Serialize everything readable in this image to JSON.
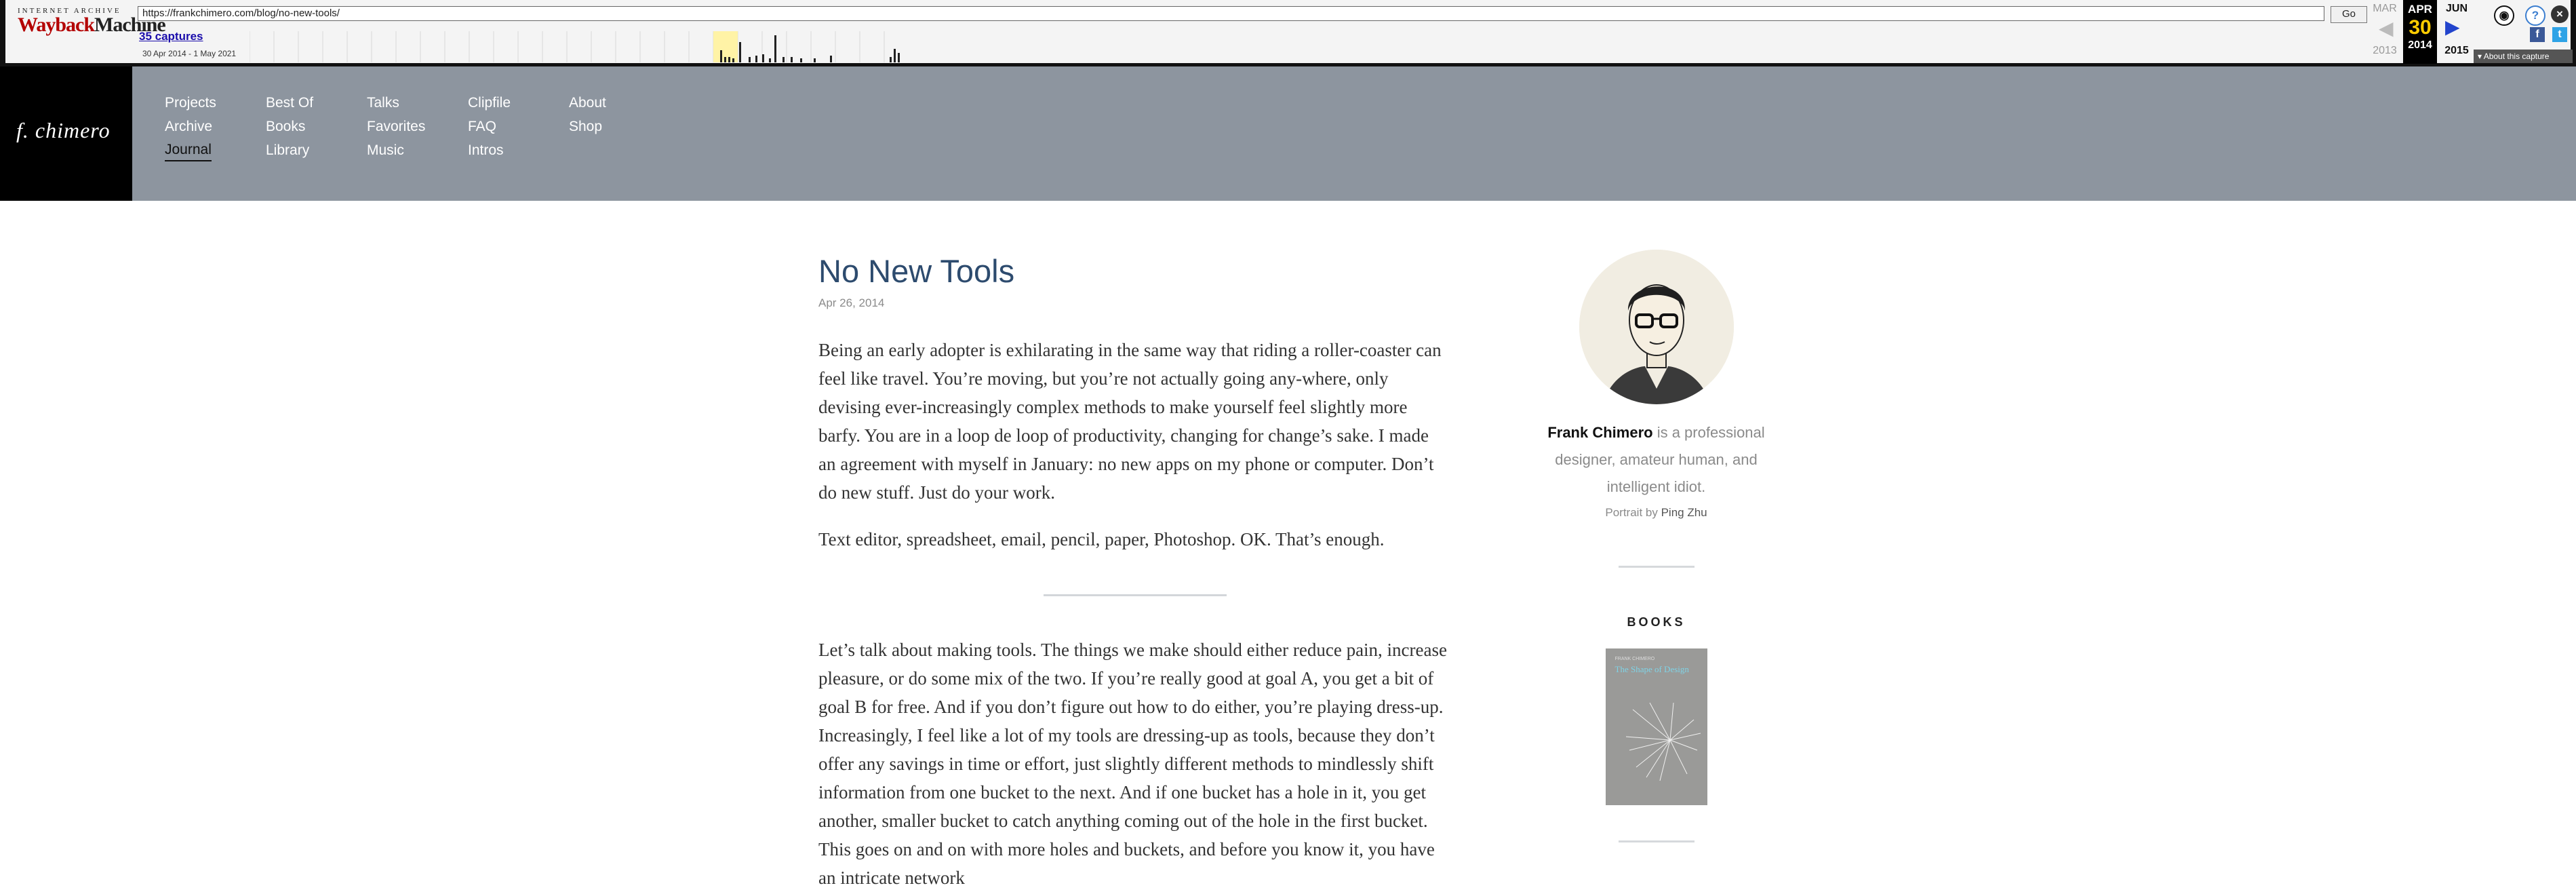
{
  "wayback": {
    "logo_top": "INTERNET ARCHIVE",
    "logo_main_red": "Wayback",
    "logo_main_dark": "Machine",
    "url": "https://frankchimero.com/blog/no-new-tools/",
    "go_label": "Go",
    "captures": "35 captures",
    "range": "30 Apr 2014 - 1 May 2021",
    "prev_month": "MAR",
    "prev_year": "2013",
    "current_month": "APR",
    "current_day": "30",
    "current_year": "2014",
    "next_month": "JUN",
    "next_year": "2015",
    "about_capture": "About this capture",
    "sparkline_heights": [
      0.45,
      0.2,
      0.2,
      0.15,
      0.75,
      0.2,
      0.25,
      0.3,
      0.15,
      1.0,
      0.2,
      0.2,
      0.15,
      0.15,
      0.25,
      0.2,
      0.5,
      0.35
    ],
    "accent": "#ffcc00"
  },
  "site": {
    "logo_text": "f. chimero",
    "nav": [
      [
        "Projects",
        "Archive",
        "Journal"
      ],
      [
        "Best Of",
        "Books",
        "Library"
      ],
      [
        "Talks",
        "Favorites",
        "Music"
      ],
      [
        "Clipfile",
        "FAQ",
        "Intros"
      ],
      [
        "About",
        "Shop"
      ]
    ],
    "active_nav": "Journal"
  },
  "post": {
    "title": "No New Tools",
    "date": "Apr 26, 2014",
    "paragraphs": [
      "Being an early adopter is exhilarating in the same way that riding a roller-coaster can feel like travel. You’re moving, but you’re not actually going any-where, only devising ever-increasingly complex methods to make yourself feel slightly more barfy. You are in a loop de loop of productivity, changing for change’s sake. I made an agreement with myself in January: no new apps on my phone or computer. Don’t do new stuff. Just do your work.",
      "Text editor, spreadsheet, email, pencil, paper, Photoshop. OK. That’s enough.",
      "Let’s talk about making tools. The things we make should either reduce pain, increase pleasure, or do some mix of the two. If you’re really good at goal A, you get a bit of goal B for free. And if you don’t figure out how to do either, you’re playing dress-up. Increasingly, I feel like a lot of my tools are dressing-up as tools, because they don’t offer any savings in time or effort, just slightly different methods to mindlessly shift information from one bucket to the next. And if one bucket has a hole in it, you get another, smaller bucket to catch anything coming out of the hole in the first bucket. This goes on and on with more holes and buckets, and before you know it, you have an intricate network"
    ]
  },
  "sidebar": {
    "name": "Frank Chimero",
    "bio_rest": " is a professional designer, amateur human, and intelligent idiot.",
    "credit_prefix": "Portrait by ",
    "credit_name": "Ping Zhu",
    "books_heading": "BOOKS",
    "book_small": "FRANK CHIMERO",
    "book_title": "The Shape of Design"
  }
}
